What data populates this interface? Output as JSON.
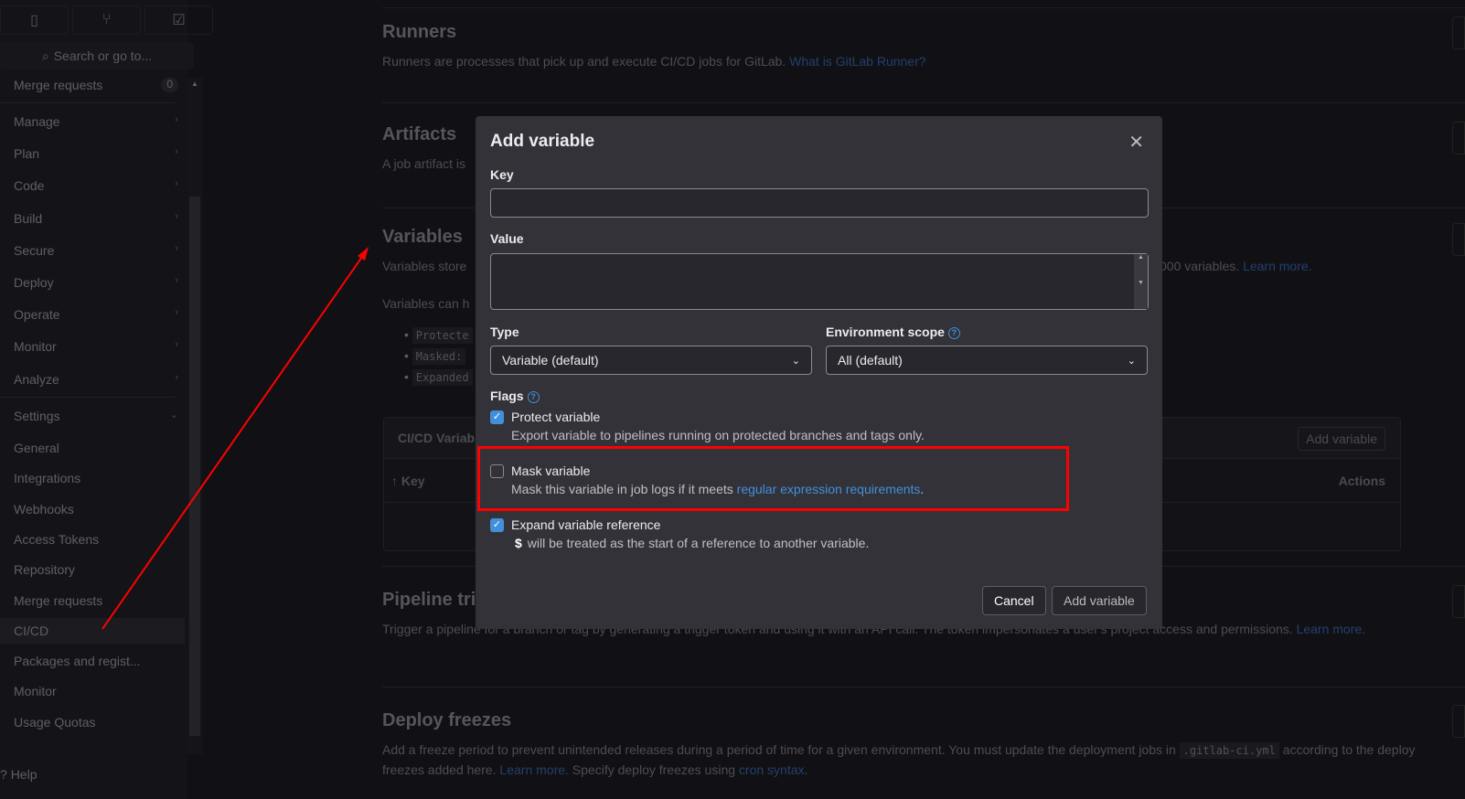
{
  "sidebar": {
    "search_placeholder": "Search or go to...",
    "merge_requests": {
      "label": "Merge requests",
      "count": "0"
    },
    "groups": [
      "Manage",
      "Plan",
      "Code",
      "Build",
      "Secure",
      "Deploy",
      "Operate",
      "Monitor",
      "Analyze"
    ],
    "settings": "Settings",
    "settings_items": [
      "General",
      "Integrations",
      "Webhooks",
      "Access Tokens",
      "Repository",
      "Merge requests",
      "CI/CD",
      "Packages and regist...",
      "Monitor",
      "Usage Quotas"
    ],
    "active_item": "CI/CD",
    "help": "Help"
  },
  "background": {
    "runners": {
      "title": "Runners",
      "desc": "Runners are processes that pick up and execute CI/CD jobs for GitLab.",
      "link": "What is GitLab Runner?"
    },
    "artifacts": {
      "title": "Artifacts",
      "desc": "A job artifact is"
    },
    "variables": {
      "title": "Variables",
      "desc": "Variables store",
      "desc_tail": "000 variables.",
      "learn": "Learn more.",
      "can": "Variables can h",
      "bullets": [
        "Protecte",
        "Masked:",
        "Expanded"
      ],
      "table": {
        "title": "CI/CD Variab",
        "add": "Add variable",
        "key": "Key",
        "actions": "Actions"
      }
    },
    "pipeline": {
      "title": "Pipeline tri",
      "desc": "Trigger a pipeline for a branch or tag by generating a trigger token and using it with an API call. The token impersonates a user's project access and permissions.",
      "link": "Learn more."
    },
    "deploy": {
      "title": "Deploy freezes",
      "desc1": "Add a freeze period to prevent unintended releases during a period of time for a given environment. You must update the deployment jobs in",
      "code": ".gitlab-ci.yml",
      "desc2": "according to the deploy freezes added here.",
      "learn": "Learn more.",
      "desc3": "Specify deploy freezes using",
      "cron": "cron syntax",
      "end": "."
    }
  },
  "modal": {
    "title": "Add variable",
    "key_label": "Key",
    "key_value": "",
    "value_label": "Value",
    "value_value": "",
    "type_label": "Type",
    "type_value": "Variable (default)",
    "env_label": "Environment scope",
    "env_value": "All (default)",
    "flags_label": "Flags",
    "flags": [
      {
        "title": "Protect variable",
        "desc": "Export variable to pipelines running on protected branches and tags only.",
        "checked": true
      },
      {
        "title": "Mask variable",
        "desc": "Mask this variable in job logs if it meets",
        "link": "regular expression requirements",
        "end": ".",
        "checked": false
      },
      {
        "title": "Expand variable reference",
        "code": "$",
        "desc": "will be treated as the start of a reference to another variable.",
        "checked": true
      }
    ],
    "cancel": "Cancel",
    "submit": "Add variable"
  },
  "annotation_color": "#ff0000"
}
